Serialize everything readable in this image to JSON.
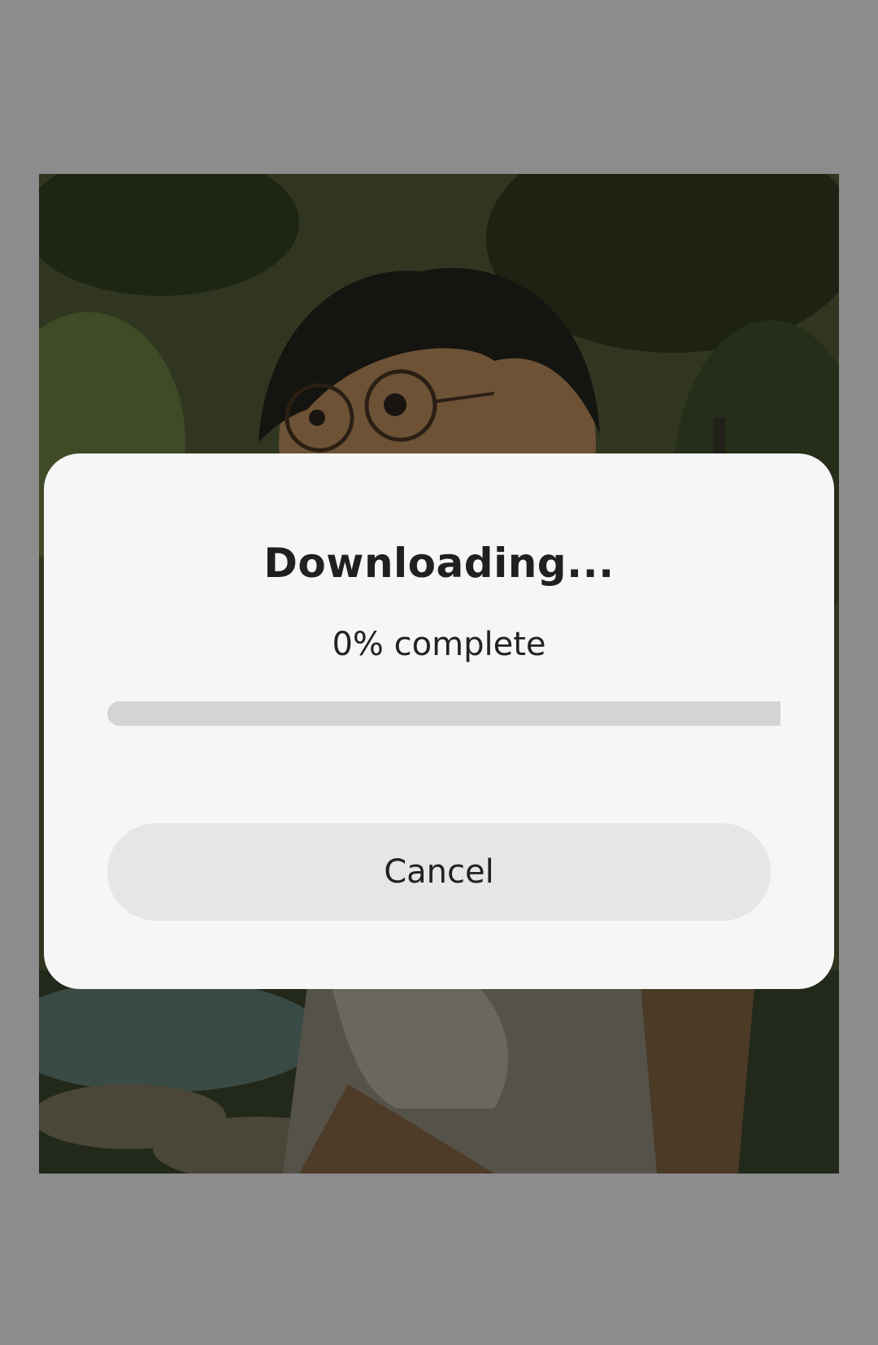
{
  "dialog": {
    "title": "Downloading...",
    "progress_text": "0% complete",
    "progress_value": 0,
    "cancel_label": "Cancel"
  },
  "colors": {
    "backdrop": "#8c8c8c",
    "dialog_bg": "#f6f6f6",
    "progress_track": "#d4d4d4",
    "button_bg": "#e6e6e6",
    "text": "#202020"
  }
}
